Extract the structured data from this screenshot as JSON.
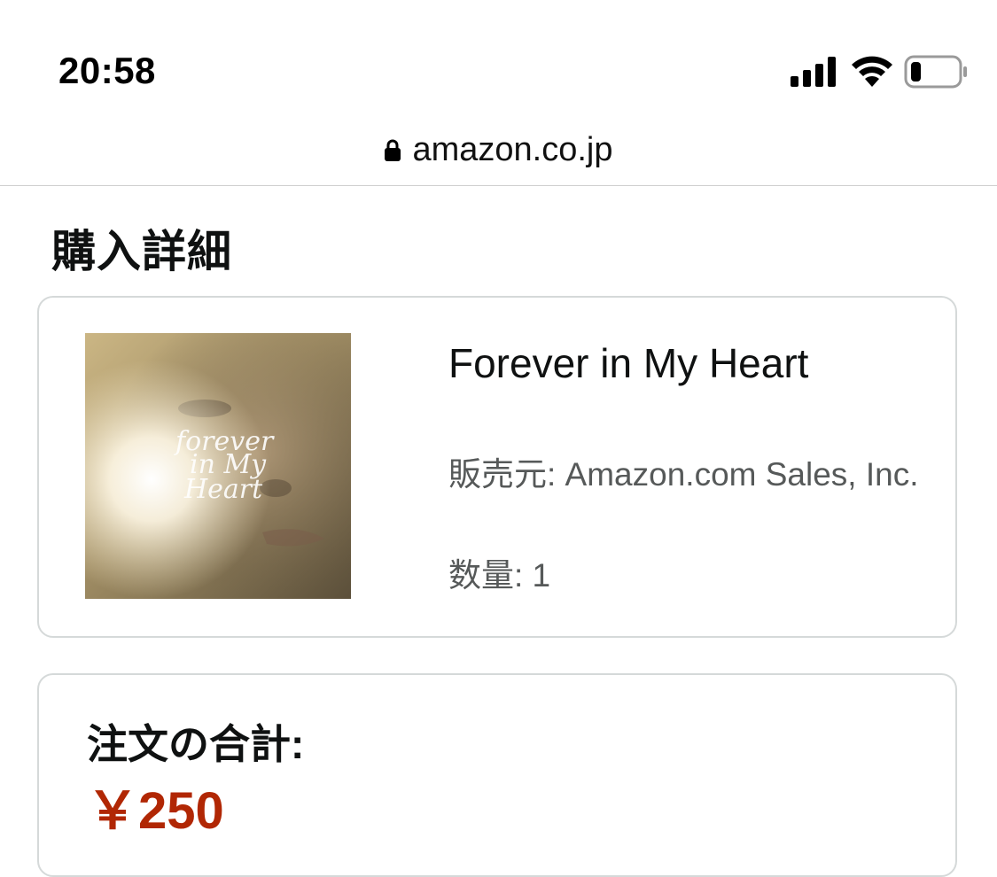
{
  "status_bar": {
    "time": "20:58",
    "icons": [
      "signal-icon",
      "wifi-icon",
      "battery-icon"
    ],
    "battery_level": 0.2
  },
  "browser": {
    "url": "amazon.co.jp",
    "secure_icon": "lock-icon"
  },
  "page": {
    "title": "購入詳細"
  },
  "item": {
    "title": "Forever in My Heart",
    "album_art_text": [
      "forever",
      "in My",
      "Heart"
    ],
    "seller": "販売元: Amazon.com Sales, Inc.",
    "quantity": "数量: 1"
  },
  "order_total": {
    "label": "注文の合計:",
    "amount": "￥250"
  },
  "colors": {
    "price": "#b12704",
    "border": "#d5d9d9",
    "secondary_text": "#565959"
  }
}
